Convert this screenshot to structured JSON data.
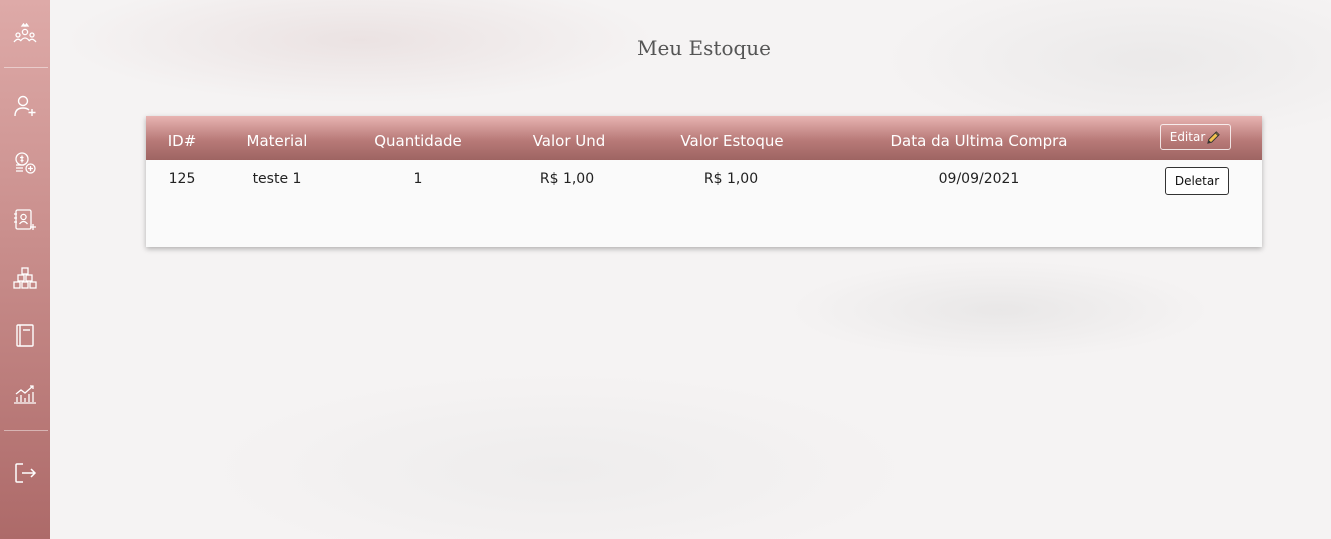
{
  "sidebar": {
    "icons": [
      "team-icon",
      "add-user-icon",
      "add-coin-icon",
      "add-contact-icon",
      "stock-boxes-icon",
      "book-icon",
      "chart-icon",
      "logout-icon"
    ]
  },
  "page": {
    "title": "Meu Estoque"
  },
  "table": {
    "headers": {
      "id": "ID#",
      "material": "Material",
      "quantidade": "Quantidade",
      "valor_und": "Valor Und",
      "valor_estoque": "Valor Estoque",
      "data": "Data da Ultima Compra"
    },
    "edit_label": "Editar",
    "rows": [
      {
        "id": "125",
        "material": "teste 1",
        "quantidade": "1",
        "valor_und": "R$ 1,00",
        "valor_estoque": "R$ 1,00",
        "data": "09/09/2021",
        "delete_label": "Deletar"
      }
    ]
  },
  "colors": {
    "sidebar_top": "#deaaa8",
    "sidebar_bottom": "#ad6a69",
    "header_top": "#e8b4b2",
    "header_bottom": "#9e6462"
  }
}
